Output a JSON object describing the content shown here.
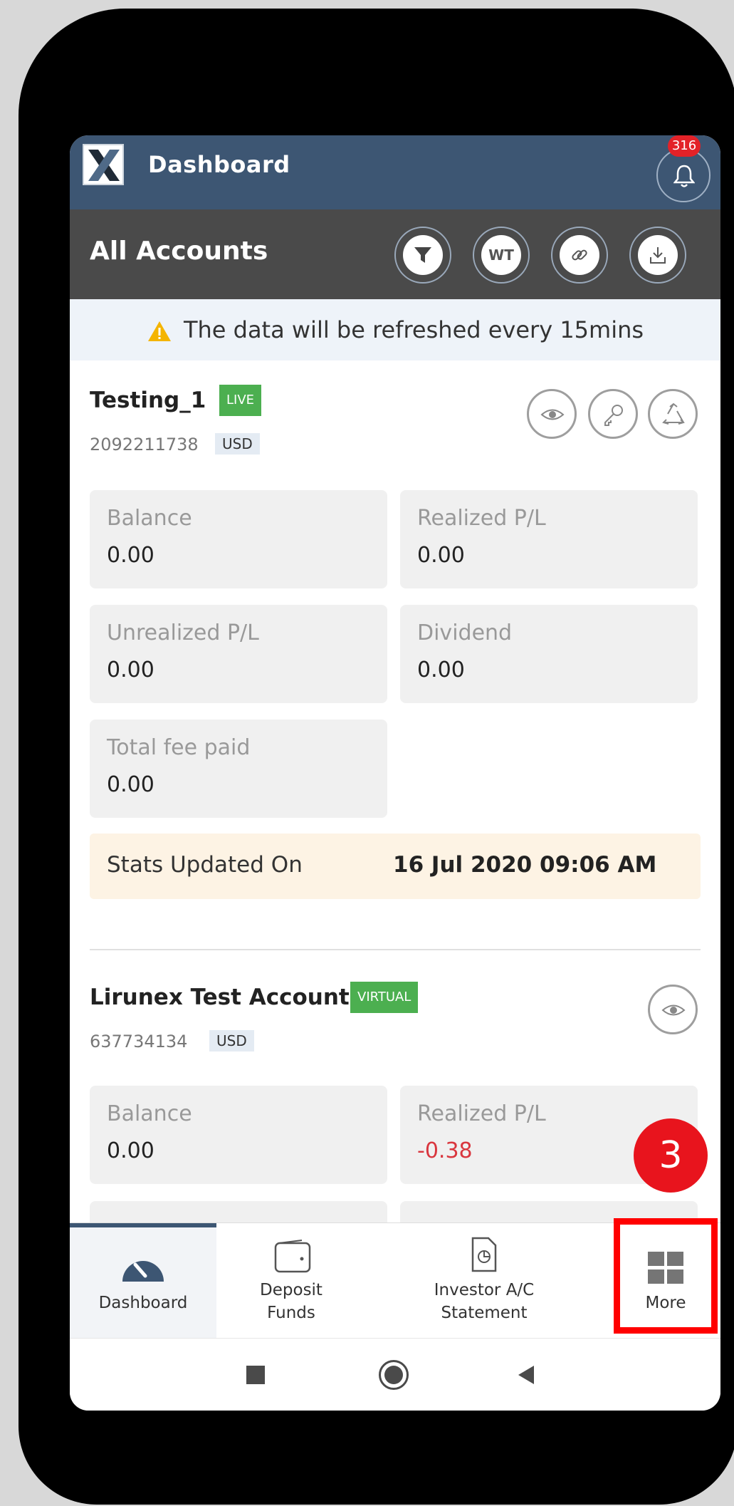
{
  "header": {
    "title": "Dashboard",
    "notification_count": "316"
  },
  "account_bar": {
    "title": "All Accounts",
    "tools": [
      "filter-icon",
      "WT",
      "link-icon",
      "download-icon"
    ],
    "wt_label": "WT"
  },
  "notice": {
    "text": "The data will be refreshed every 15mins",
    "icon": "warning-icon"
  },
  "accounts": [
    {
      "name": "Testing_1",
      "type": "LIVE",
      "number": "2092211738",
      "currency": "USD",
      "actions": [
        "eye-icon",
        "key-icon",
        "recycle-icon"
      ],
      "stats": [
        {
          "label": "Balance",
          "value": "0.00"
        },
        {
          "label": "Realized P/L",
          "value": "0.00"
        },
        {
          "label": "Unrealized P/L",
          "value": "0.00"
        },
        {
          "label": "Dividend",
          "value": "0.00"
        },
        {
          "label": "Total fee paid",
          "value": "0.00"
        }
      ],
      "updated_label": "Stats Updated On",
      "updated_value": "16 Jul 2020 09:06 AM"
    },
    {
      "name": "Lirunex Test Account",
      "type": "VIRTUAL",
      "number": "637734134",
      "currency": "USD",
      "actions": [
        "eye-icon"
      ],
      "stats": [
        {
          "label": "Balance",
          "value": "0.00"
        },
        {
          "label": "Realized P/L",
          "value": "-0.38"
        }
      ]
    }
  ],
  "step_marker": "3",
  "bottom_nav": [
    {
      "label": "Dashboard",
      "icon": "gauge-icon",
      "active": true
    },
    {
      "label": "Deposit\nFunds",
      "icon": "wallet-icon",
      "active": false
    },
    {
      "label": "Investor A/C\nStatement",
      "icon": "statement-icon",
      "active": false
    },
    {
      "label": "More",
      "icon": "grid-icon",
      "active": false
    }
  ],
  "system_nav": [
    "recents-icon",
    "home-icon",
    "back-icon"
  ],
  "colors": {
    "header_bg": "#3d5673",
    "account_bar_bg": "#4a4a4a",
    "live_tag": "#4caf50",
    "negative": "#d9363e",
    "highlight": "#ff0000"
  }
}
